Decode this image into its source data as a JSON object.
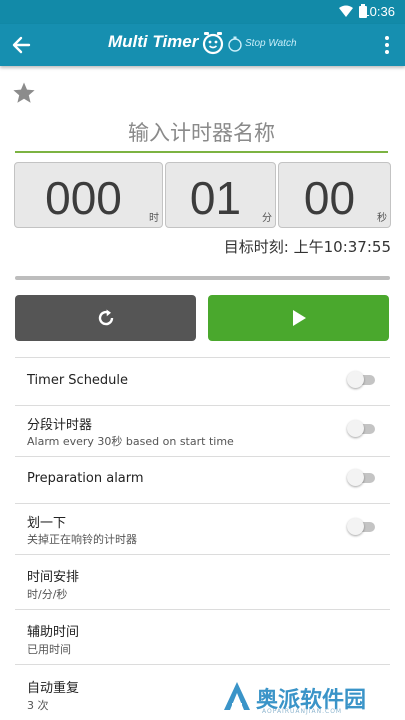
{
  "status_bar": {
    "time": "10:36"
  },
  "app_bar": {
    "title": "Multi Timer",
    "subtitle": "Stop Watch"
  },
  "timer": {
    "name_placeholder": "输入计时器名称",
    "hours": "000",
    "hours_unit": "时",
    "minutes": "01",
    "minutes_unit": "分",
    "seconds": "00",
    "seconds_unit": "秒",
    "target_time": "目标时刻: 上午10:37:55"
  },
  "settings": [
    {
      "title": "Timer Schedule",
      "toggle": false
    },
    {
      "title": "分段计时器",
      "subtitle": "Alarm every 30秒 based on start time",
      "toggle": false
    },
    {
      "title": "Preparation alarm",
      "toggle": false
    },
    {
      "title": "划一下",
      "subtitle": "关掉正在响铃的计时器",
      "toggle": false
    },
    {
      "title": "时间安排",
      "subtitle": "时/分/秒"
    },
    {
      "title": "辅助时间",
      "subtitle": "已用时间"
    },
    {
      "title": "自动重复",
      "subtitle": "3 次"
    }
  ],
  "watermark": {
    "text": "奥派软件园",
    "url": "AOPAIRUANJIAN.COM"
  },
  "colors": {
    "primary": "#168fb0",
    "start_button": "#4aa82d",
    "reset_button": "#555555",
    "accent_line": "#7cb342"
  },
  "icons": {
    "back": "arrow-left-icon",
    "more": "more-vert-icon",
    "favorite": "star-icon",
    "reset": "refresh-icon",
    "start": "play-icon"
  }
}
